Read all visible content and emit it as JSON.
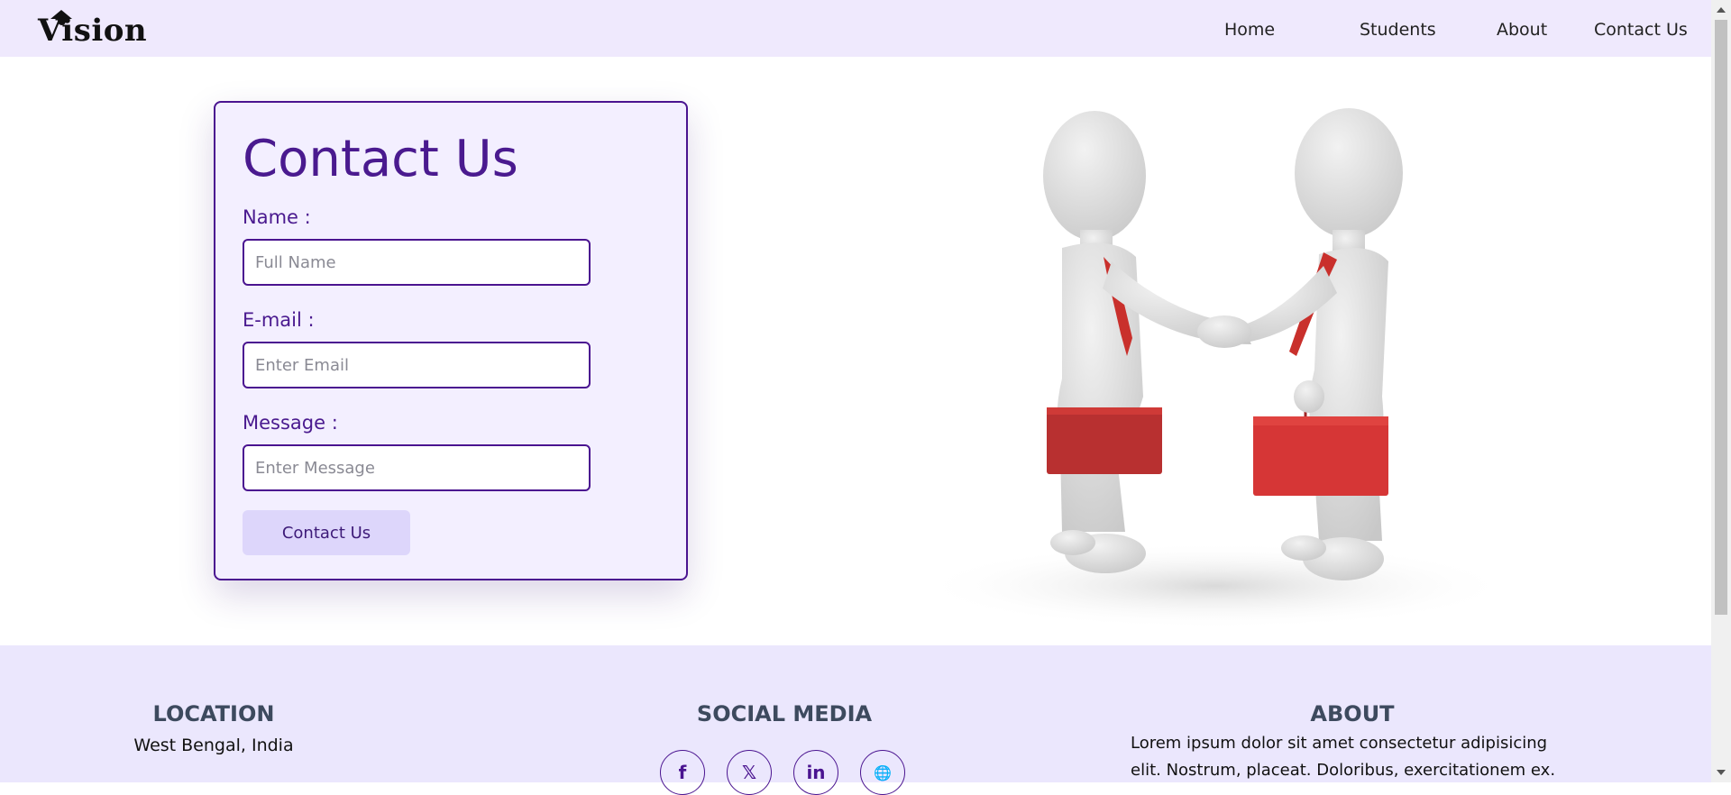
{
  "header": {
    "logo": "Vision",
    "nav": [
      {
        "label": "Home"
      },
      {
        "label": "Students"
      },
      {
        "label": "About"
      },
      {
        "label": "Contact Us"
      }
    ]
  },
  "contact_form": {
    "title": "Contact Us",
    "name_label": "Name :",
    "name_placeholder": "Full Name",
    "email_label": "E-mail :",
    "email_placeholder": "Enter Email",
    "message_label": "Message :",
    "message_placeholder": "Enter Message",
    "submit_label": "Contact Us"
  },
  "illustration": {
    "icon": "handshake-3d-figures-illustration"
  },
  "footer": {
    "location_heading": "LOCATION",
    "location_text": "West Bengal, India",
    "social_heading": "SOCIAL MEDIA",
    "social_icons": [
      {
        "icon": "facebook-icon",
        "glyph": "f"
      },
      {
        "icon": "x-twitter-icon",
        "glyph": "𝕏"
      },
      {
        "icon": "linkedin-icon",
        "glyph": "in"
      },
      {
        "icon": "globe-icon",
        "glyph": "🌐"
      }
    ],
    "about_heading": "ABOUT",
    "about_line1": "Lorem ipsum dolor sit amet consectetur adipisicing",
    "about_line2": "elit. Nostrum, placeat. Doloribus, exercitationem ex."
  },
  "colors": {
    "accent": "#4a1490",
    "header_bg": "#efe9fd",
    "card_bg": "#f3efff",
    "footer_bg": "#ebe7fd",
    "button_bg": "#ddd6fb"
  }
}
